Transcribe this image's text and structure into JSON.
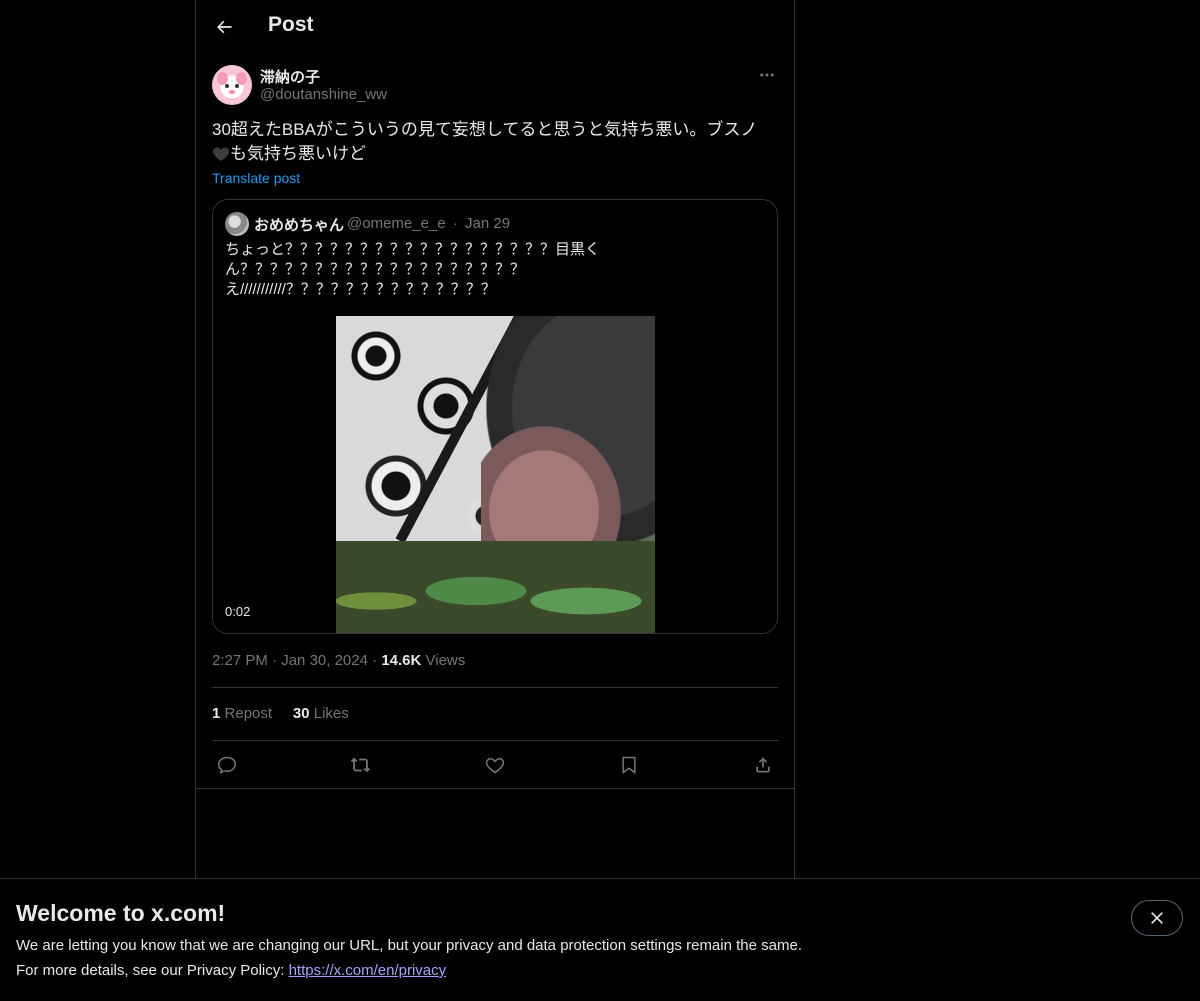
{
  "header": {
    "title": "Post"
  },
  "post": {
    "display_name": "滞納の子",
    "handle": "@doutanshine_ww",
    "text_line1": "30超えたBBAがこういうの見て妄想してると思うと気持ち悪い。ブスノ",
    "text_line2": "も気持ち悪いけど",
    "translate_label": "Translate post",
    "time": "2:27 PM",
    "date": "Jan 30, 2024",
    "views_count": "14.6K",
    "views_label": "Views",
    "reposts_count": "1",
    "reposts_label": "Repost",
    "likes_count": "30",
    "likes_label": "Likes"
  },
  "quote": {
    "display_name": "おめめちゃん",
    "handle": "@omeme_e_e",
    "separator": "·",
    "date": "Jan 29",
    "text_line1": "ちょっと？？？？？？？？？？？？？？？？？？目黒く",
    "text_line2": "ん？？？？？？？？？？？？？？？？？？？",
    "text_line3": "え///////////？？？？？？？？？？？？？？",
    "video_duration": "0:02"
  },
  "actions": [
    "reply-icon",
    "repost-icon",
    "like-icon",
    "bookmark-icon",
    "share-icon"
  ],
  "banner": {
    "title": "Welcome to x.com!",
    "line1": "We are letting you know that we are changing our URL, but your privacy and data protection settings remain the same.",
    "line2_prefix": "For more details, see our Privacy Policy: ",
    "link": "https://x.com/en/privacy"
  },
  "colors": {
    "background": "#000000",
    "text": "#e7e9ea",
    "muted": "#71767b",
    "accent": "#1d9bf0",
    "border": "#2f3336"
  }
}
